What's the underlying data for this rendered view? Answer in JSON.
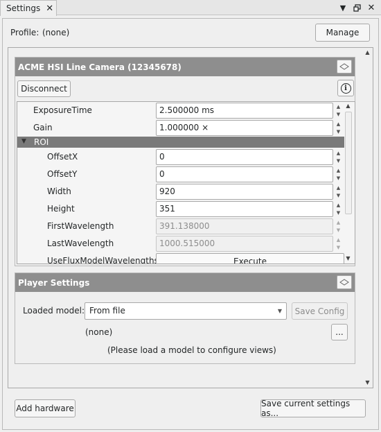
{
  "window": {
    "tab_title": "Settings",
    "icons": [
      "close-icon",
      "chevron-down-icon",
      "restore-icon",
      "close-icon"
    ]
  },
  "profile": {
    "label": "Profile:",
    "value": "(none)",
    "manage_label": "Manage"
  },
  "camera": {
    "title": "ACME HSI Line Camera (12345678)",
    "disconnect_label": "Disconnect",
    "info_glyph": "i",
    "properties": [
      {
        "name": "ExposureTime",
        "value": "2.500000 ms",
        "enabled": true
      },
      {
        "name": "Gain",
        "value": "1.000000 ×",
        "enabled": true
      }
    ],
    "roi": {
      "label": "ROI",
      "properties": [
        {
          "name": "OffsetX",
          "value": "0",
          "enabled": true
        },
        {
          "name": "OffsetY",
          "value": "0",
          "enabled": true
        },
        {
          "name": "Width",
          "value": "920",
          "enabled": true
        },
        {
          "name": "Height",
          "value": "351",
          "enabled": true
        },
        {
          "name": "FirstWavelength",
          "value": "391.138000",
          "enabled": false
        },
        {
          "name": "LastWavelength",
          "value": "1000.515000",
          "enabled": false
        },
        {
          "name": "UseFluxModelWavelengths",
          "action": "Execute"
        }
      ]
    }
  },
  "player": {
    "title": "Player Settings",
    "loaded_model_label": "Loaded model:",
    "loaded_model_value": "From file",
    "save_config_label": "Save Config",
    "model_path": "(none)",
    "browse_label": "...",
    "hint": "(Please load a model to configure views)"
  },
  "footer": {
    "add_hardware_label": "Add hardware",
    "save_current_label": "Save current settings as..."
  },
  "colors": {
    "group_header": "#8e8e8e",
    "roi_header": "#7a7a7a",
    "background": "#efefef"
  }
}
